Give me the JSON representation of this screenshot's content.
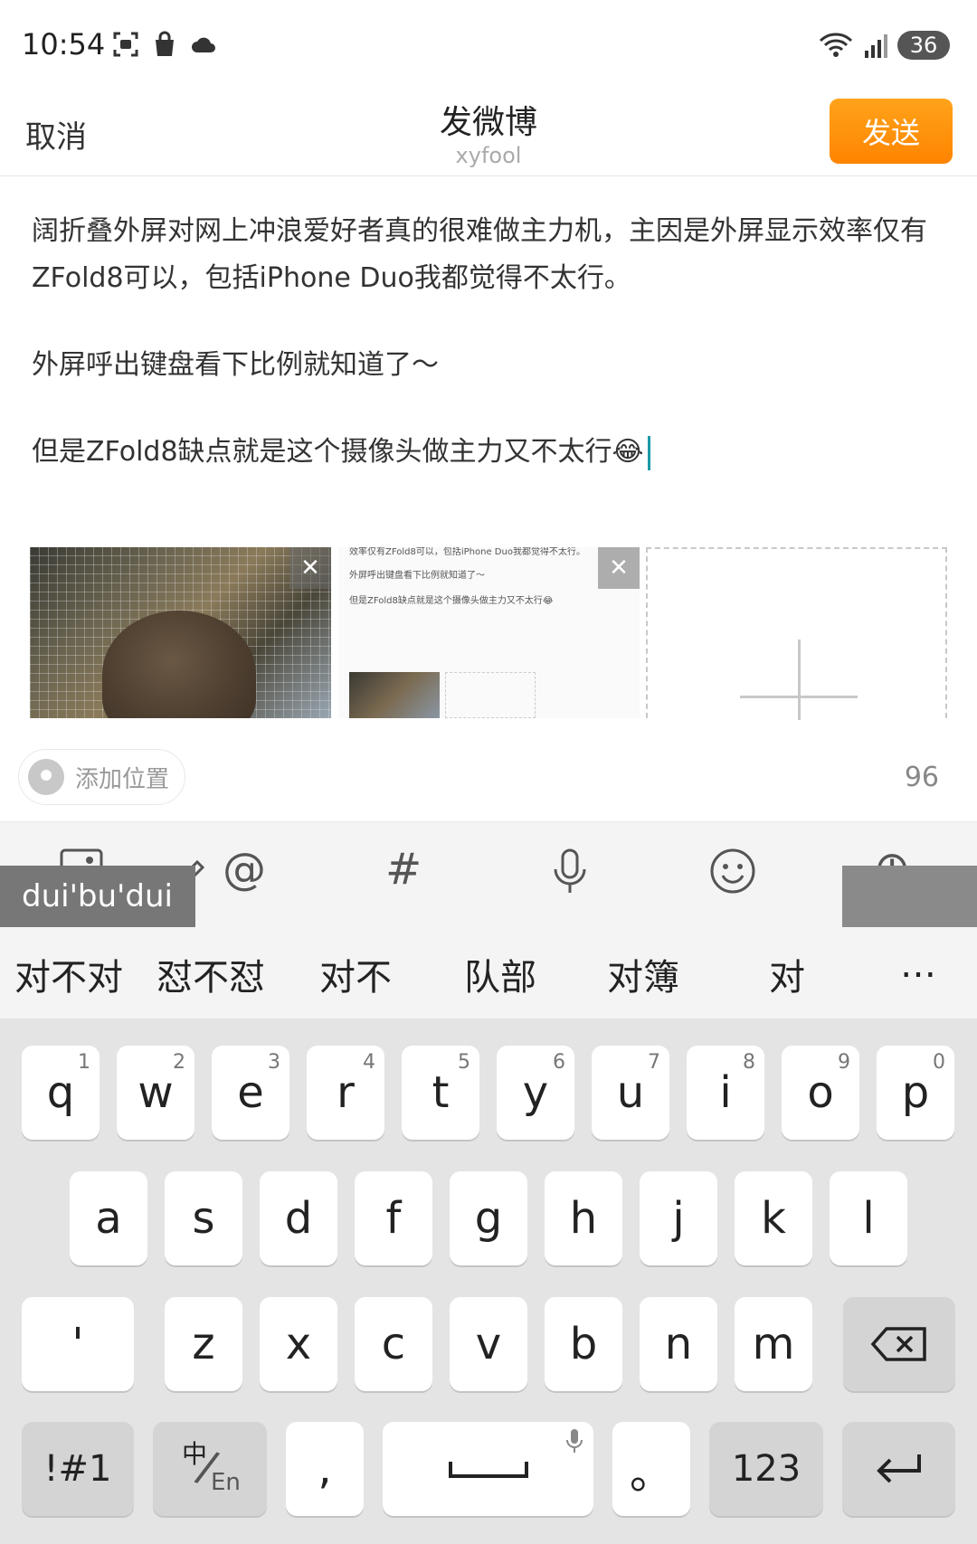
{
  "status_bar": {
    "time": "10:54",
    "left_icons": [
      "screenshot-icon",
      "shopping-bag-icon",
      "cloud-icon"
    ],
    "right_icons": [
      "wifi-icon",
      "signal-icon"
    ],
    "battery": "36"
  },
  "header": {
    "cancel_label": "取消",
    "title": "发微博",
    "username": "xyfool",
    "send_label": "发送"
  },
  "post": {
    "paragraphs": [
      "阔折叠外屏对网上冲浪爱好者真的很难做主力机，主因是外屏显示效率仅有ZFold8可以，包括iPhone Duo我都觉得不太行。",
      "外屏呼出键盘看下比例就知道了～",
      "但是ZFold8缺点就是这个摄像头做主力又不太行😂"
    ]
  },
  "attachments": {
    "mini_preview_lines": [
      "效率仅有ZFold8可以，包括iPhone Duo我都觉得不太行。",
      "外屏呼出键盘看下比例就知道了～",
      "但是ZFold8缺点就是这个摄像头做主力又不太行😂"
    ],
    "close_symbol": "✕"
  },
  "location": {
    "label": "添加位置",
    "char_count": "96"
  },
  "toolbar": {
    "items": [
      "image-icon",
      "mention-icon",
      "hashtag-icon",
      "microphone-icon",
      "emoji-icon",
      "more-icon"
    ],
    "mention": "@",
    "hashtag": "#",
    "plus": "⊕"
  },
  "ime": {
    "composing": "dui'bu'dui",
    "candidates": [
      "对不对",
      "怼不怼",
      "对不",
      "队部",
      "对簿",
      "对"
    ],
    "more": "…"
  },
  "keyboard": {
    "row1": [
      {
        "key": "q",
        "num": "1"
      },
      {
        "key": "w",
        "num": "2"
      },
      {
        "key": "e",
        "num": "3"
      },
      {
        "key": "r",
        "num": "4"
      },
      {
        "key": "t",
        "num": "5"
      },
      {
        "key": "y",
        "num": "6"
      },
      {
        "key": "u",
        "num": "7"
      },
      {
        "key": "i",
        "num": "8"
      },
      {
        "key": "o",
        "num": "9"
      },
      {
        "key": "p",
        "num": "0"
      }
    ],
    "row2": [
      "a",
      "s",
      "d",
      "f",
      "g",
      "h",
      "j",
      "k",
      "l"
    ],
    "row3_left": "'",
    "row3": [
      "z",
      "x",
      "c",
      "v",
      "b",
      "n",
      "m"
    ],
    "backspace": "⌫",
    "symbols": "!#1",
    "lang_top": "中",
    "lang_bottom": "En",
    "comma": ",",
    "period": "。",
    "numbers": "123",
    "enter": "↵"
  }
}
